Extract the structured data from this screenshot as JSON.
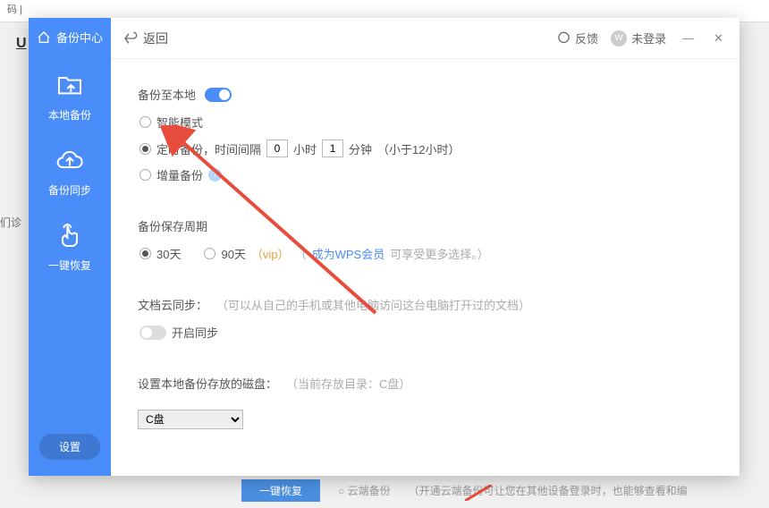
{
  "bg": {
    "topline": "码 |",
    "u": "U",
    "side": "们诊",
    "restore_btn": "一键恢复",
    "cloud_backup": "云端备份",
    "cloud_hint": "（开通云端备份可让您在其他设备登录时，也能够查看和编"
  },
  "sidebar": {
    "title": "备份中心",
    "items": [
      {
        "label": "本地备份"
      },
      {
        "label": "备份同步"
      },
      {
        "label": "一键恢复"
      }
    ],
    "settings": "设置"
  },
  "topbar": {
    "back": "返回",
    "feedback": "反馈",
    "login": "未登录",
    "avatar_letter": "W"
  },
  "backup_local": {
    "title": "备份至本地",
    "smart_mode": "智能模式",
    "scheduled_label": "定时备份，时间间隔",
    "hour_val": "0",
    "hour_unit": "小时",
    "min_val": "1",
    "min_unit": "分钟",
    "limit_hint": "（小于12小时）",
    "incremental": "增量备份"
  },
  "retention": {
    "title": "备份保存周期",
    "opt30": "30天",
    "opt90": "90天",
    "vip": "（vip）",
    "wps_link": "成为WPS会员",
    "more_hint": " 可享受更多选择。）",
    "paren_open": "（ "
  },
  "cloud_sync": {
    "title": "文档云同步：",
    "hint": "（可以从自己的手机或其他电脑访问这台电脑打开过的文档）",
    "enable": "开启同步"
  },
  "disk": {
    "title": "设置本地备份存放的磁盘：",
    "current": "（当前存放目录：C盘）",
    "selected": "C盘"
  }
}
